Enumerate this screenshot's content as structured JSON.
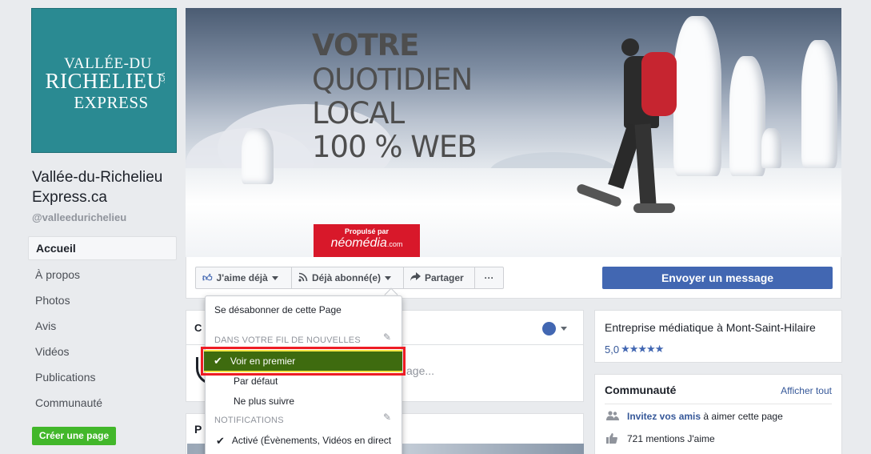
{
  "profile": {
    "logo_line1": "VALLÉE-DU",
    "logo_line2": "RICHELIEU",
    "logo_line3": "EXPRESS",
    "logo_suffix": ".CA",
    "name": "Vallée-du-Richelieu Express.ca",
    "handle": "@valleedurichelieu"
  },
  "nav": {
    "items": [
      "Accueil",
      "À propos",
      "Photos",
      "Avis",
      "Vidéos",
      "Publications",
      "Communauté"
    ],
    "active_index": 0,
    "create_page": "Créer une page"
  },
  "cover": {
    "line1": "VOTRE",
    "line2": "QUOTIDIEN",
    "line3": "LOCAL",
    "line4": "100 % WEB",
    "badge_top": "Propulsé par",
    "badge_brand": "néomédia",
    "badge_tld": ".com"
  },
  "actions": {
    "like": "J'aime déjà",
    "follow": "Déjà abonné(e)",
    "share": "Partager",
    "more": "···",
    "message": "Envoyer un message"
  },
  "follow_menu": {
    "unsubscribe": "Se désabonner de cette Page",
    "feed_section": "DANS VOTRE FIL DE NOUVELLES",
    "see_first": "Voir en premier",
    "default": "Par défaut",
    "unfollow": "Ne plus suivre",
    "notif_section": "NOTIFICATIONS",
    "active": "Activé (Évènements, Vidéos en direct"
  },
  "post_box": {
    "header": "C",
    "placeholder_tail": "age..."
  },
  "posts": {
    "header": "P"
  },
  "about": {
    "category": "Entreprise médiatique à Mont-Saint-Hilaire",
    "rating": "5,0",
    "stars": 5
  },
  "community": {
    "title": "Communauté",
    "see_all": "Afficher tout",
    "invite_link": "Invitez vos amis",
    "invite_rest": " à aimer cette page",
    "likes": "721 mentions J'aime"
  },
  "colors": {
    "brand_blue": "#4267b2",
    "create_green": "#42b72a",
    "highlight_red": "#ee1c24",
    "highlight_fill": "#3e6b0f",
    "badge_red": "#d8182a",
    "logo_teal": "#2a8a92"
  }
}
